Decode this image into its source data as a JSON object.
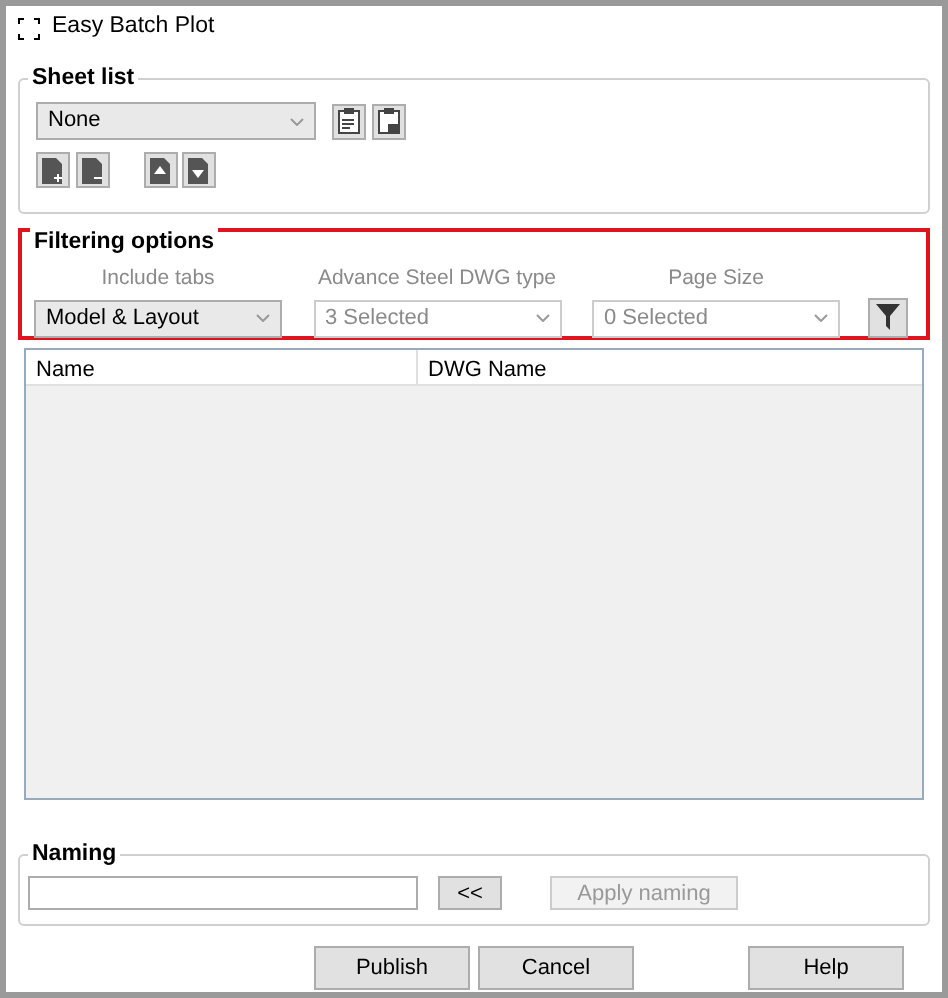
{
  "window": {
    "title": "Easy Batch Plot"
  },
  "sheet_list": {
    "title": "Sheet list",
    "selection": "None"
  },
  "filtering": {
    "title": "Filtering options",
    "highlighted": true,
    "filters": [
      {
        "label": "Include tabs",
        "value": "Model & Layout",
        "disabled": false
      },
      {
        "label": "Advance Steel DWG type",
        "value": "3 Selected",
        "disabled": true
      },
      {
        "label": "Page Size",
        "value": "0 Selected",
        "disabled": true
      }
    ]
  },
  "table": {
    "columns": [
      "Name",
      "DWG Name"
    ]
  },
  "naming": {
    "title": "Naming",
    "move_button": "<<",
    "apply_button": {
      "label": "Apply naming",
      "disabled": true
    }
  },
  "buttons": [
    "Publish",
    "Cancel",
    "Help"
  ]
}
